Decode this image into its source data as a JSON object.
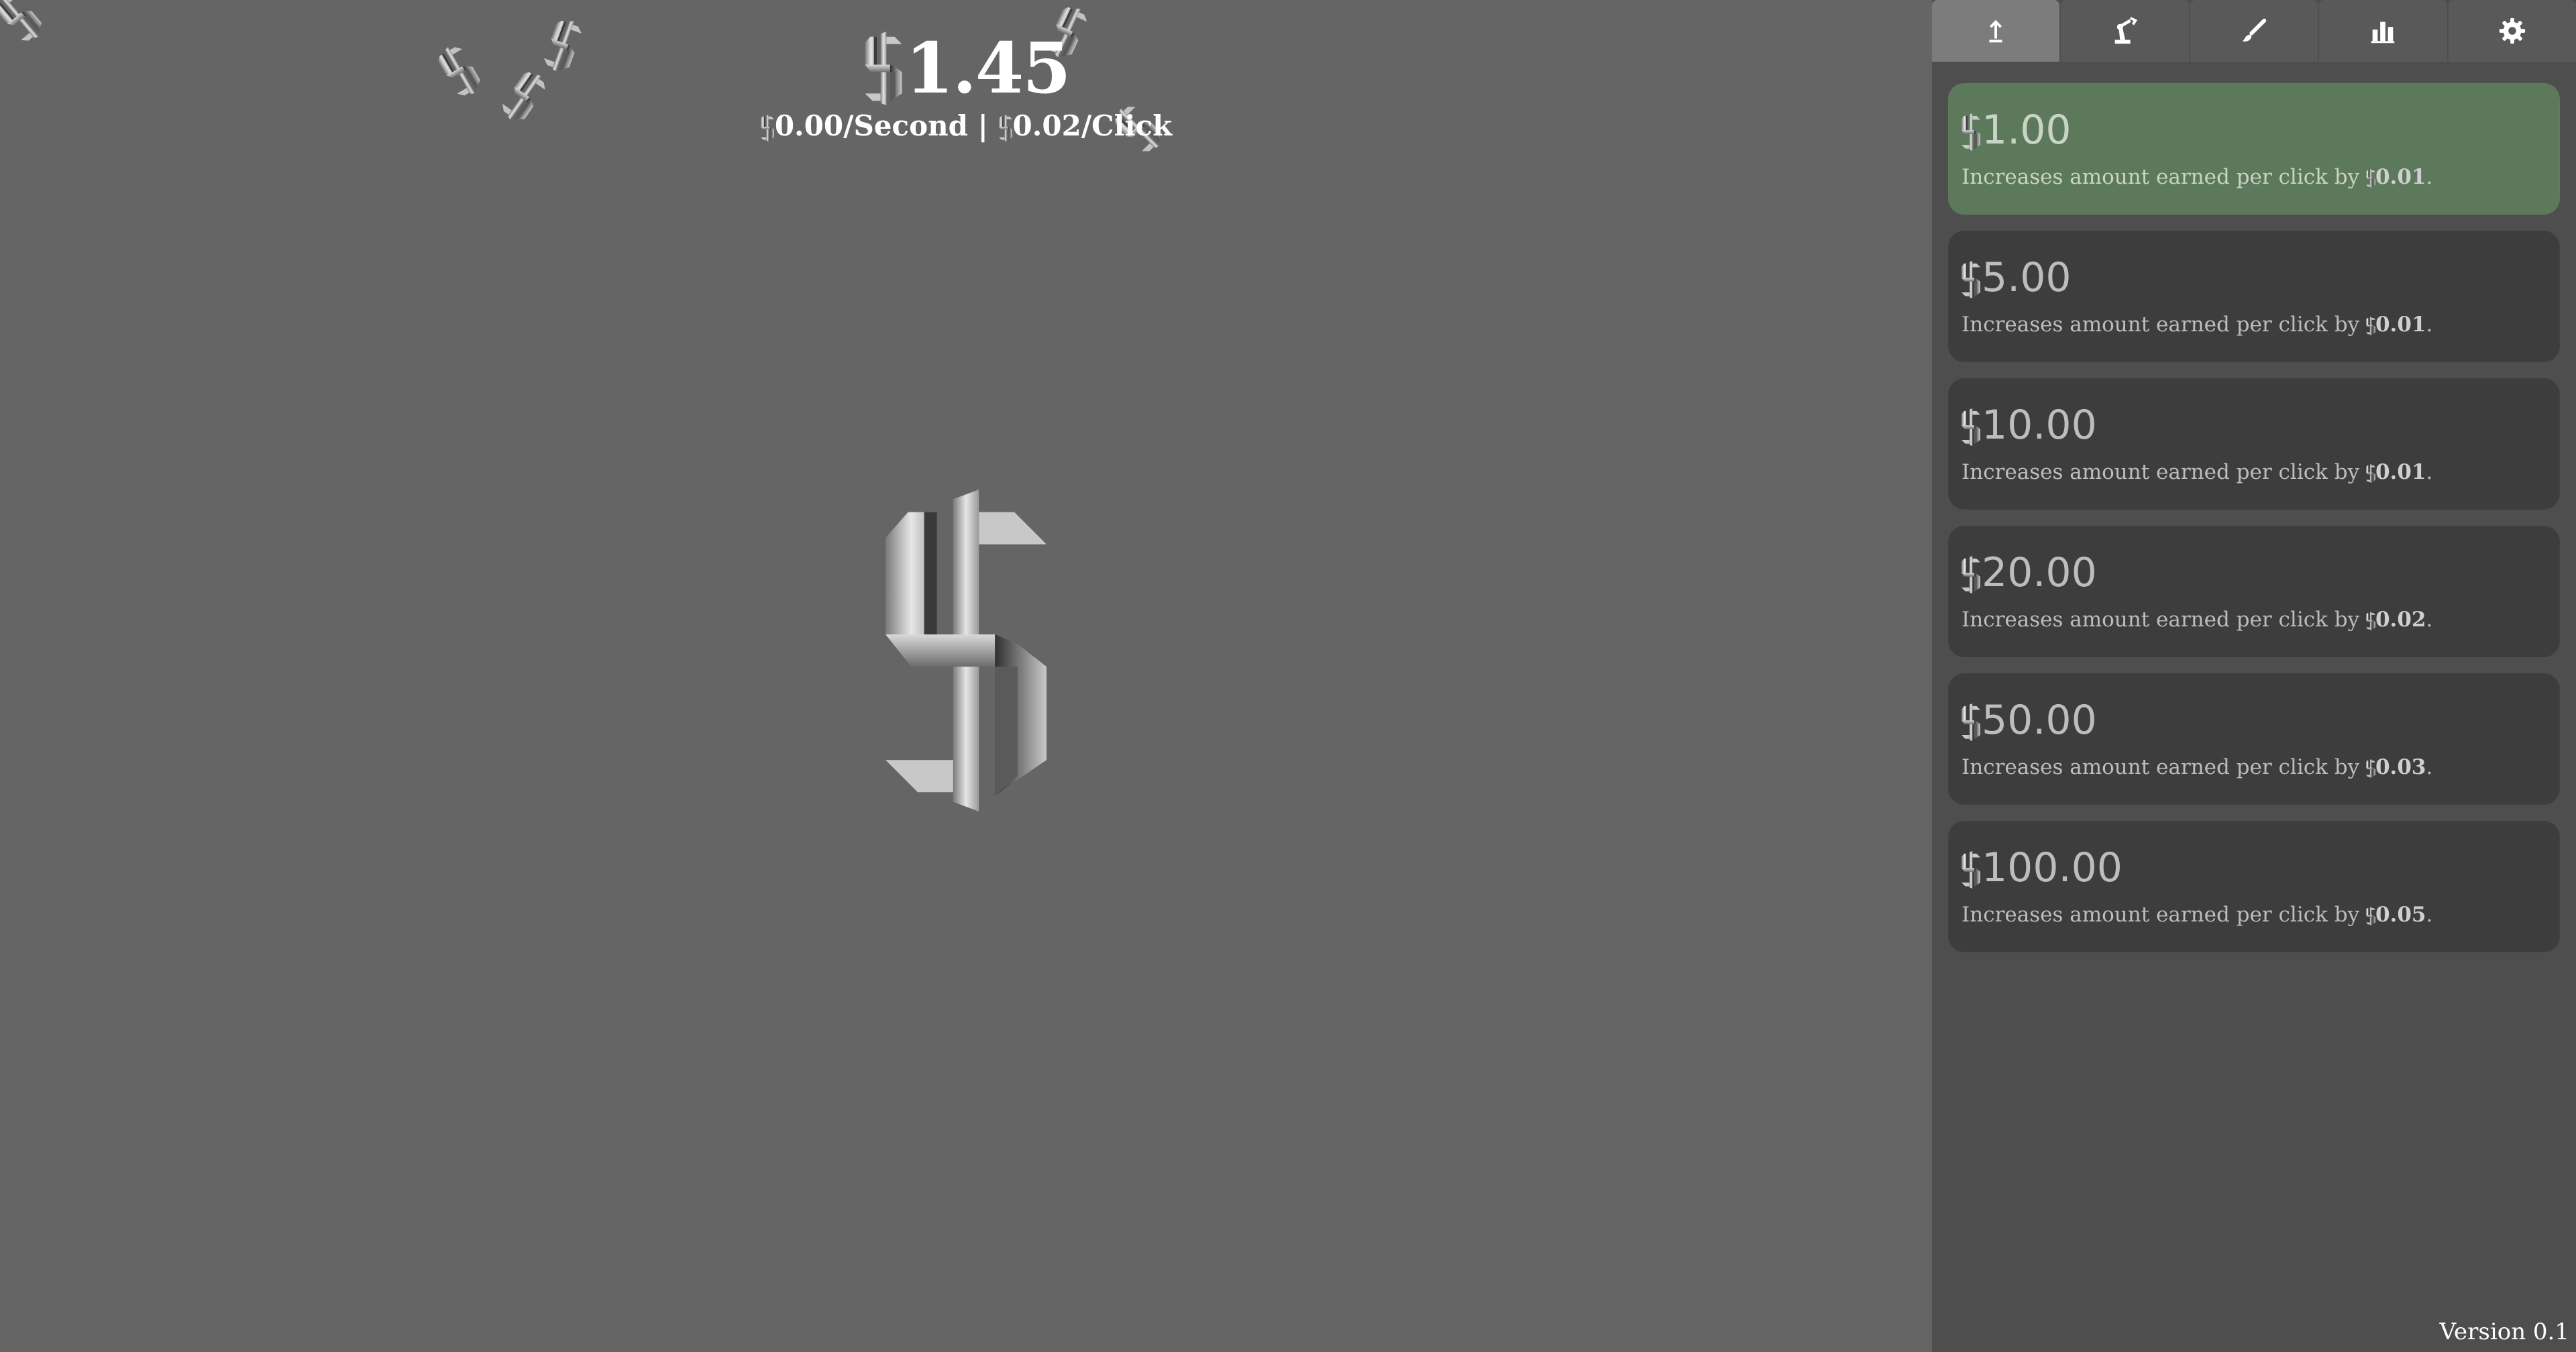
{
  "header": {
    "money": "1.45",
    "per_second": "0.00/Second",
    "separator": "|",
    "per_click": "0.02/Click"
  },
  "tabs": [
    {
      "name": "upgrades",
      "icon": "arrow-up-icon",
      "active": true
    },
    {
      "name": "automation",
      "icon": "robot-arm-icon",
      "active": false
    },
    {
      "name": "cosmetics",
      "icon": "brush-icon",
      "active": false
    },
    {
      "name": "stats",
      "icon": "bar-chart-icon",
      "active": false
    },
    {
      "name": "settings",
      "icon": "gear-icon",
      "active": false
    }
  ],
  "upgrades": [
    {
      "price": "1.00",
      "desc_prefix": "Increases amount earned per click by",
      "amount": "0.01",
      "desc_suffix": ".",
      "affordable": true
    },
    {
      "price": "5.00",
      "desc_prefix": "Increases amount earned per click by",
      "amount": "0.01",
      "desc_suffix": ".",
      "affordable": false
    },
    {
      "price": "10.00",
      "desc_prefix": "Increases amount earned per click by",
      "amount": "0.01",
      "desc_suffix": ".",
      "affordable": false
    },
    {
      "price": "20.00",
      "desc_prefix": "Increases amount earned per click by",
      "amount": "0.02",
      "desc_suffix": ".",
      "affordable": false
    },
    {
      "price": "50.00",
      "desc_prefix": "Increases amount earned per click by",
      "amount": "0.03",
      "desc_suffix": ".",
      "affordable": false
    },
    {
      "price": "100.00",
      "desc_prefix": "Increases amount earned per click by",
      "amount": "0.05",
      "desc_suffix": ".",
      "affordable": false
    }
  ],
  "footer": {
    "version": "Version 0.1"
  },
  "colors": {
    "background": "#656565",
    "sidebar": "#4e4e4e",
    "card": "#3d3d3d",
    "card_affordable": "#5d795b",
    "active_tab": "#7c7c7c"
  }
}
